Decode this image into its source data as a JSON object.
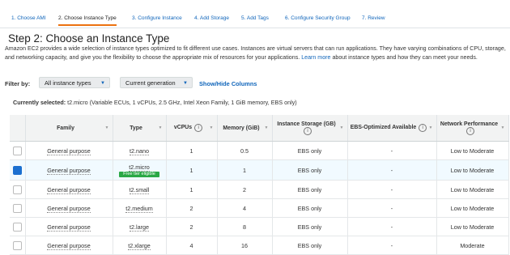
{
  "wizard_steps": [
    {
      "label": "1. Choose AMI",
      "active": false
    },
    {
      "label": "2. Choose Instance Type",
      "active": true
    },
    {
      "label": "3. Configure Instance",
      "active": false
    },
    {
      "label": "4. Add Storage",
      "active": false
    },
    {
      "label": "5. Add Tags",
      "active": false
    },
    {
      "label": "6. Configure Security Group",
      "active": false
    },
    {
      "label": "7. Review",
      "active": false
    }
  ],
  "page": {
    "title": "Step 2: Choose an Instance Type",
    "description_text": "Amazon EC2 provides a wide selection of instance types optimized to fit different use cases. Instances are virtual servers that can run applications. They have varying combinations of CPU, storage, and networking capacity, and give you the flexibility to choose the appropriate mix of resources for your applications. ",
    "description_link": "Learn more",
    "description_tail": " about instance types and how they can meet your needs."
  },
  "filters": {
    "label": "Filter by:",
    "type_select": "All instance types",
    "generation_select": "Current generation",
    "toggle_columns": "Show/Hide Columns"
  },
  "current_selection": {
    "label": "Currently selected:",
    "value": "t2.micro (Variable ECUs, 1 vCPUs, 2.5 GHz, Intel Xeon Family, 1 GiB memory, EBS only)"
  },
  "table": {
    "headers": {
      "family": "Family",
      "type": "Type",
      "vcpus": "vCPUs",
      "memory": "Memory (GiB)",
      "storage": "Instance Storage (GB)",
      "ebs": "EBS-Optimized Available",
      "network": "Network Performance"
    },
    "rows": [
      {
        "family": "General purpose",
        "type": "t2.nano",
        "badge": "",
        "vcpus": "1",
        "memory": "0.5",
        "storage": "EBS only",
        "ebs": "-",
        "network": "Low to Moderate",
        "selected": false
      },
      {
        "family": "General purpose",
        "type": "t2.micro",
        "badge": "Free tier eligible",
        "vcpus": "1",
        "memory": "1",
        "storage": "EBS only",
        "ebs": "-",
        "network": "Low to Moderate",
        "selected": true
      },
      {
        "family": "General purpose",
        "type": "t2.small",
        "badge": "",
        "vcpus": "1",
        "memory": "2",
        "storage": "EBS only",
        "ebs": "-",
        "network": "Low to Moderate",
        "selected": false
      },
      {
        "family": "General purpose",
        "type": "t2.medium",
        "badge": "",
        "vcpus": "2",
        "memory": "4",
        "storage": "EBS only",
        "ebs": "-",
        "network": "Low to Moderate",
        "selected": false
      },
      {
        "family": "General purpose",
        "type": "t2.large",
        "badge": "",
        "vcpus": "2",
        "memory": "8",
        "storage": "EBS only",
        "ebs": "-",
        "network": "Low to Moderate",
        "selected": false
      },
      {
        "family": "General purpose",
        "type": "t2.xlarge",
        "badge": "",
        "vcpus": "4",
        "memory": "16",
        "storage": "EBS only",
        "ebs": "-",
        "network": "Moderate",
        "selected": false
      }
    ]
  },
  "colors": {
    "accent": "#1166bb",
    "active_tab": "#ec7211",
    "badge": "#2aa845",
    "selected_row": "#f1faff"
  }
}
